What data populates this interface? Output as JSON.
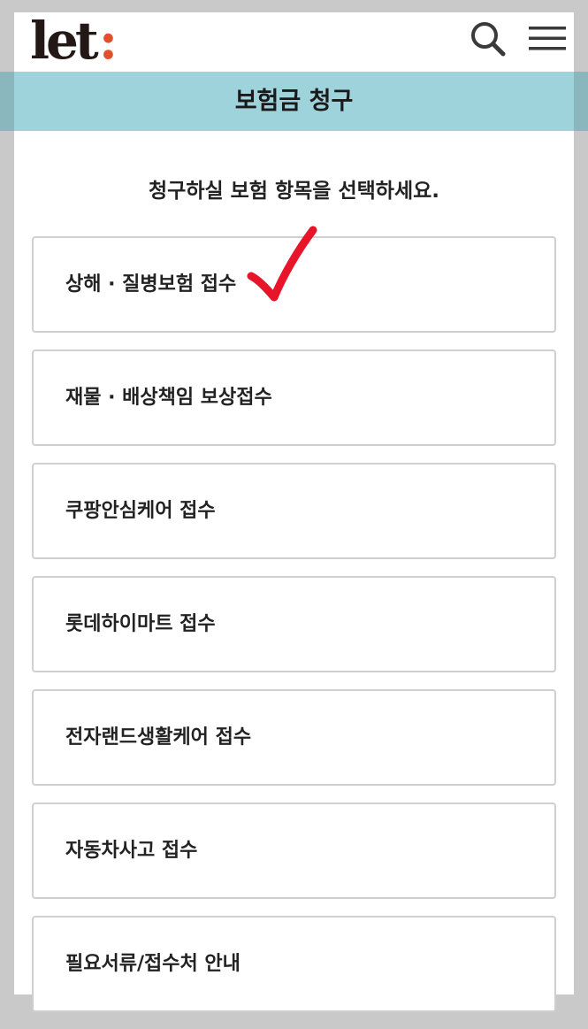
{
  "header": {
    "logo_text": "let",
    "logo_colon": ":",
    "logo_colon_color": "#e0502d",
    "search_icon": "search-icon",
    "menu_icon": "hamburger-menu-icon"
  },
  "banner": {
    "title": "보험금 청구",
    "color": "#9fd3dc"
  },
  "main": {
    "subtitle": "청구하실 보험 항목을 선택하세요.",
    "options": [
      {
        "label": "상해 · 질병보험 접수"
      },
      {
        "label": "재물 · 배상책임 보상접수"
      },
      {
        "label": "쿠팡안심케어 접수"
      },
      {
        "label": "롯데하이마트 접수"
      },
      {
        "label": "전자랜드생활케어 접수"
      },
      {
        "label": "자동차사고 접수"
      },
      {
        "label": "필요서류/접수처 안내"
      }
    ]
  },
  "annotation": {
    "icon": "red-checkmark-icon",
    "color": "#e8152a"
  }
}
